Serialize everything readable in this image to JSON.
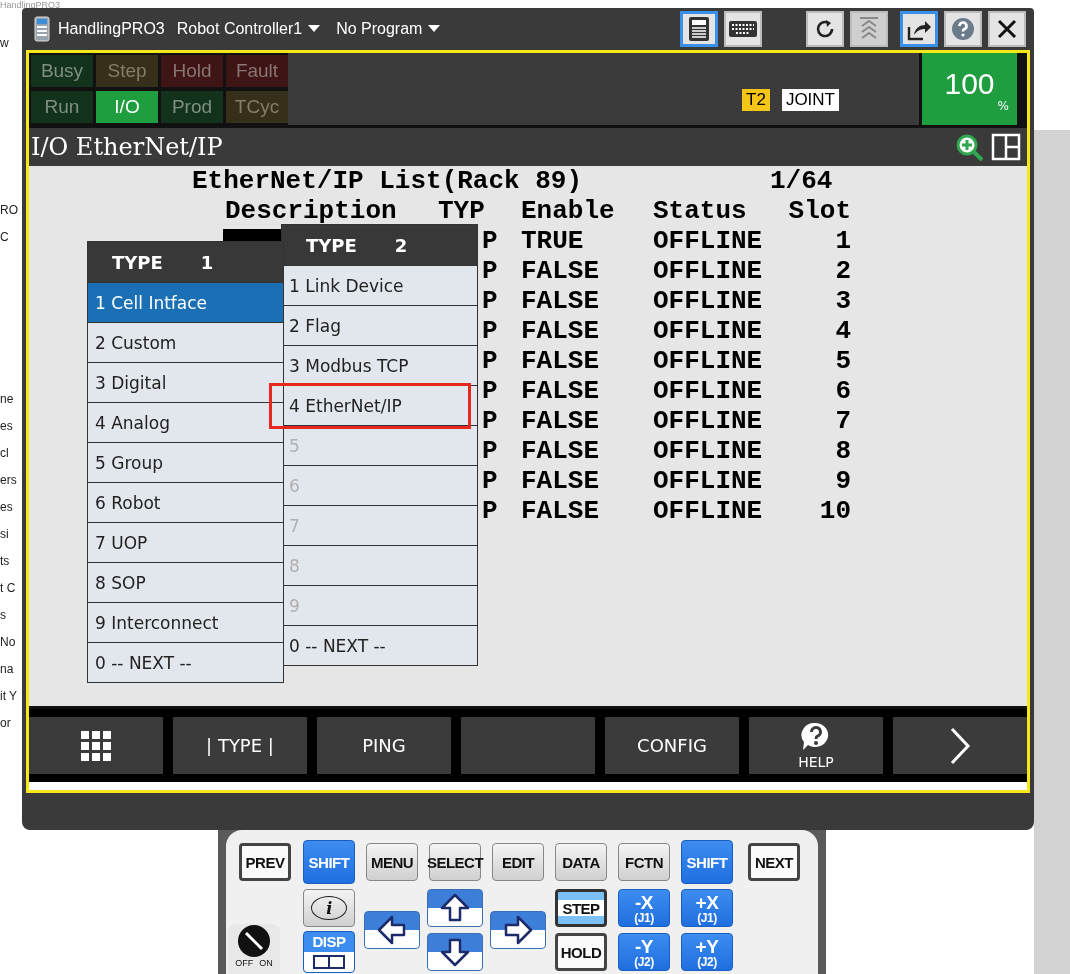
{
  "background_app": {
    "title": "HandlingPRO3",
    "fragments": [
      "w",
      "RO",
      "C",
      "ne",
      "es",
      "cl",
      "ers",
      "es",
      "si",
      "ts",
      "t C",
      "s",
      "No",
      "na",
      "it Y",
      "or"
    ]
  },
  "title_bar": {
    "app": "HandlingPRO3",
    "controller": "Robot Controller1",
    "program": "No Program",
    "buttons": [
      {
        "kind": "pendant",
        "selected": true,
        "disabled": false
      },
      {
        "kind": "keyboard",
        "selected": false,
        "disabled": false
      },
      {
        "kind": "refresh",
        "selected": false,
        "disabled": false
      },
      {
        "kind": "stack",
        "selected": false,
        "disabled": true
      },
      {
        "kind": "popout",
        "selected": true,
        "disabled": false
      },
      {
        "kind": "help",
        "selected": false,
        "disabled": false
      },
      {
        "kind": "close",
        "selected": false,
        "disabled": false
      }
    ]
  },
  "status_lamps": [
    {
      "label": "Busy",
      "kind": "green",
      "on": false
    },
    {
      "label": "Step",
      "kind": "amber",
      "on": false
    },
    {
      "label": "Hold",
      "kind": "red",
      "on": false
    },
    {
      "label": "Fault",
      "kind": "red",
      "on": false
    },
    {
      "label": "Run",
      "kind": "green",
      "on": false
    },
    {
      "label": "I/O",
      "kind": "green",
      "on": true
    },
    {
      "label": "Prod",
      "kind": "green",
      "on": false
    },
    {
      "label": "TCyc",
      "kind": "amber",
      "on": false
    }
  ],
  "badges": [
    {
      "kind": "mode",
      "label": "T2"
    },
    {
      "kind": "coord",
      "label": "JOINT"
    }
  ],
  "override": {
    "value": "100",
    "unit": "%"
  },
  "screen": {
    "title": "I/O EtherNet/IP",
    "list_title": "EtherNet/IP List(Rack 89)",
    "page": "1/64",
    "columns": [
      "Description",
      "TYP",
      "Enable",
      "Status",
      "Slot"
    ],
    "rows": [
      {
        "selected": true,
        "typ": "P",
        "enable": "TRUE",
        "status": "OFFLINE",
        "slot": "1"
      },
      {
        "selected": false,
        "typ": "P",
        "enable": "FALSE",
        "status": "OFFLINE",
        "slot": "2"
      },
      {
        "selected": false,
        "typ": "P",
        "enable": "FALSE",
        "status": "OFFLINE",
        "slot": "3"
      },
      {
        "selected": false,
        "typ": "P",
        "enable": "FALSE",
        "status": "OFFLINE",
        "slot": "4"
      },
      {
        "selected": false,
        "typ": "P",
        "enable": "FALSE",
        "status": "OFFLINE",
        "slot": "5"
      },
      {
        "selected": false,
        "typ": "P",
        "enable": "FALSE",
        "status": "OFFLINE",
        "slot": "6"
      },
      {
        "selected": false,
        "typ": "P",
        "enable": "FALSE",
        "status": "OFFLINE",
        "slot": "7"
      },
      {
        "selected": false,
        "typ": "P",
        "enable": "FALSE",
        "status": "OFFLINE",
        "slot": "8"
      },
      {
        "selected": false,
        "typ": "P",
        "enable": "FALSE",
        "status": "OFFLINE",
        "slot": "9"
      },
      {
        "selected": false,
        "typ": "P",
        "enable": "FALSE",
        "status": "OFFLINE",
        "slot": "10"
      }
    ]
  },
  "popups": [
    {
      "title": "TYPE",
      "number": "1",
      "items": [
        {
          "label": "1 Cell Intface",
          "selected": true,
          "disabled": false,
          "marked": false
        },
        {
          "label": "2 Custom",
          "selected": false,
          "disabled": false,
          "marked": false
        },
        {
          "label": "3 Digital",
          "selected": false,
          "disabled": false,
          "marked": false
        },
        {
          "label": "4 Analog",
          "selected": false,
          "disabled": false,
          "marked": false
        },
        {
          "label": "5 Group",
          "selected": false,
          "disabled": false,
          "marked": false
        },
        {
          "label": "6 Robot",
          "selected": false,
          "disabled": false,
          "marked": false
        },
        {
          "label": "7 UOP",
          "selected": false,
          "disabled": false,
          "marked": false
        },
        {
          "label": "8 SOP",
          "selected": false,
          "disabled": false,
          "marked": false
        },
        {
          "label": "9 Interconnect",
          "selected": false,
          "disabled": false,
          "marked": false
        },
        {
          "label": "0 -- NEXT --",
          "selected": false,
          "disabled": false,
          "marked": false
        }
      ]
    },
    {
      "title": "TYPE",
      "number": "2",
      "items": [
        {
          "label": "1 Link Device",
          "selected": false,
          "disabled": false,
          "marked": false
        },
        {
          "label": "2 Flag",
          "selected": false,
          "disabled": false,
          "marked": false
        },
        {
          "label": "3 Modbus TCP",
          "selected": false,
          "disabled": false,
          "marked": false
        },
        {
          "label": "4 EtherNet/IP",
          "selected": false,
          "disabled": false,
          "marked": true
        },
        {
          "label": "5",
          "selected": false,
          "disabled": true,
          "marked": false
        },
        {
          "label": "6",
          "selected": false,
          "disabled": true,
          "marked": false
        },
        {
          "label": "7",
          "selected": false,
          "disabled": true,
          "marked": false
        },
        {
          "label": "8",
          "selected": false,
          "disabled": true,
          "marked": false
        },
        {
          "label": "9",
          "selected": false,
          "disabled": true,
          "marked": false
        },
        {
          "label": "0 -- NEXT --",
          "selected": false,
          "disabled": false,
          "marked": false
        }
      ]
    }
  ],
  "function_keys": [
    {
      "kind": "grid"
    },
    {
      "kind": "text",
      "label": "| TYPE |"
    },
    {
      "kind": "text",
      "label": "PING"
    },
    {
      "kind": "blank"
    },
    {
      "kind": "text",
      "label": "CONFIG"
    },
    {
      "kind": "help",
      "label": "HELP"
    },
    {
      "kind": "next"
    }
  ],
  "keypad": {
    "keys": [
      {
        "kind": "outline",
        "label": "PREV"
      },
      {
        "kind": "blue",
        "label": "SHIFT"
      },
      {
        "kind": "gray",
        "label": "MENU"
      },
      {
        "kind": "gray",
        "label": "SELECT"
      },
      {
        "kind": "gray",
        "label": "EDIT"
      },
      {
        "kind": "gray",
        "label": "DATA"
      },
      {
        "kind": "gray",
        "label": "FCTN"
      },
      {
        "kind": "blue",
        "label": "SHIFT"
      },
      {
        "kind": "outline",
        "label": "NEXT"
      },
      {
        "kind": "info",
        "label": "i"
      },
      {
        "kind": "left"
      },
      {
        "kind": "up"
      },
      {
        "kind": "right"
      },
      {
        "kind": "step",
        "label": "STEP"
      },
      {
        "kind": "jog",
        "label": "-X",
        "sub": "(J1)"
      },
      {
        "kind": "jog",
        "label": "+X",
        "sub": "(J1)"
      },
      {
        "kind": "disp",
        "label": "DISP"
      },
      {
        "kind": "down"
      },
      {
        "kind": "outline",
        "label": "HOLD"
      },
      {
        "kind": "jog",
        "label": "-Y",
        "sub": "(J2)"
      },
      {
        "kind": "jog",
        "label": "+Y",
        "sub": "(J2)"
      }
    ],
    "key_switch": {
      "off": "OFF",
      "on": "ON",
      "switched_on": true
    }
  }
}
